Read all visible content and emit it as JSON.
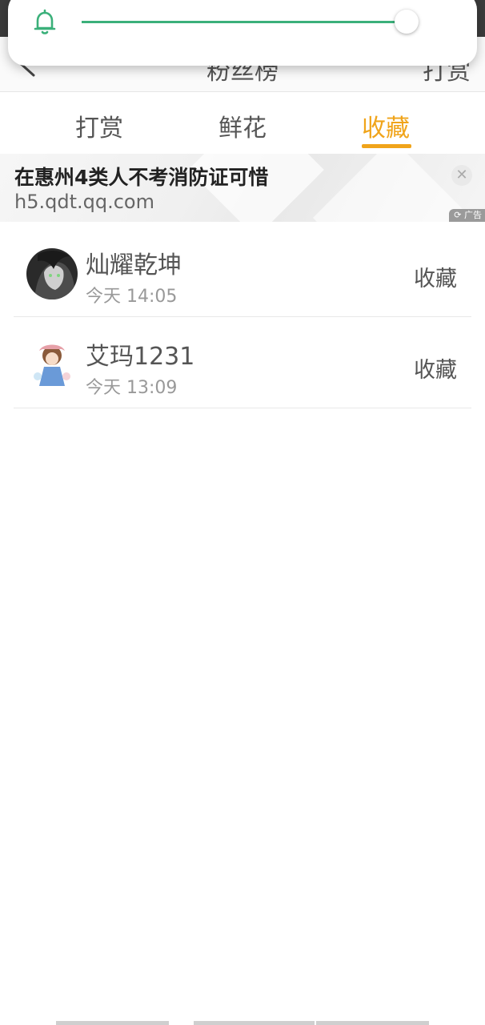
{
  "header": {
    "title": "粉丝榜",
    "action_label": "打赏"
  },
  "volume": {
    "level": 0.99,
    "accent_color": "#3bb07a"
  },
  "tabs": [
    {
      "label": "打赏",
      "active": false
    },
    {
      "label": "鲜花",
      "active": false
    },
    {
      "label": "收藏",
      "active": true
    }
  ],
  "ad": {
    "title": "在惠州4类人不考消防证可惜",
    "url": "h5.qdt.qq.com",
    "badge": "广告"
  },
  "items": [
    {
      "name": "灿耀乾坤",
      "time": "今天 14:05",
      "action": "收藏"
    },
    {
      "name": "艾玛1231",
      "time": "今天 13:09",
      "action": "收藏"
    }
  ],
  "colors": {
    "accent": "#f0a41a",
    "text": "#555555",
    "subtext": "#999999"
  }
}
